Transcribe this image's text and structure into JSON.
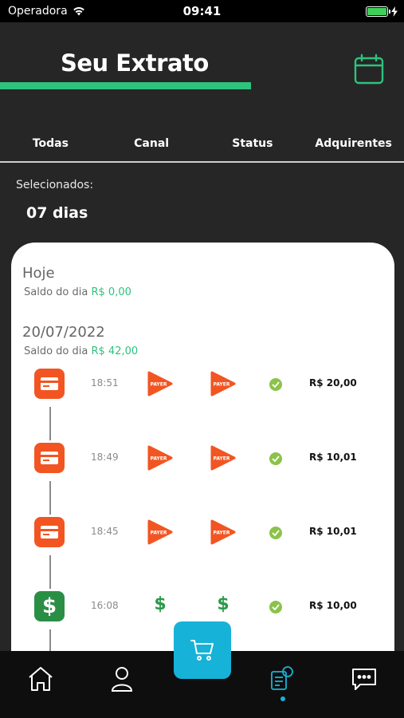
{
  "status_bar": {
    "carrier": "Operadora",
    "time": "09:41"
  },
  "header": {
    "title": "Seu Extrato",
    "accent_color": "#2ec27e"
  },
  "filters": {
    "tabs": [
      "Todas",
      "Canal",
      "Status",
      "Adquirentes"
    ]
  },
  "selection": {
    "label": "Selecionados:",
    "value": "07 dias"
  },
  "days": [
    {
      "name": "Hoje",
      "balance_label": "Saldo do dia",
      "balance_value": "R$ 0,00"
    },
    {
      "name": "20/07/2022",
      "balance_label": "Saldo do dia",
      "balance_value": "R$ 42,00"
    }
  ],
  "transactions": [
    {
      "type": "card-icon",
      "time": "18:51",
      "channel": "PAYER",
      "acquirer": "PAYER",
      "status": "check-icon",
      "amount": "R$ 20,00"
    },
    {
      "type": "card-icon",
      "time": "18:49",
      "channel": "PAYER",
      "acquirer": "PAYER",
      "status": "check-icon",
      "amount": "R$ 10,01"
    },
    {
      "type": "card-icon",
      "time": "18:45",
      "channel": "PAYER",
      "acquirer": "PAYER",
      "status": "check-icon",
      "amount": "R$ 10,01"
    },
    {
      "type": "dollar-icon",
      "time": "16:08",
      "channel": "$",
      "acquirer": "$",
      "status": "check-icon",
      "amount": "R$ 10,00"
    }
  ],
  "bottom_nav": {
    "items": [
      "home-icon",
      "user-icon",
      "cart-icon",
      "statement-icon",
      "chat-icon"
    ],
    "active": "statement-icon",
    "active_color": "#17b2d8"
  }
}
